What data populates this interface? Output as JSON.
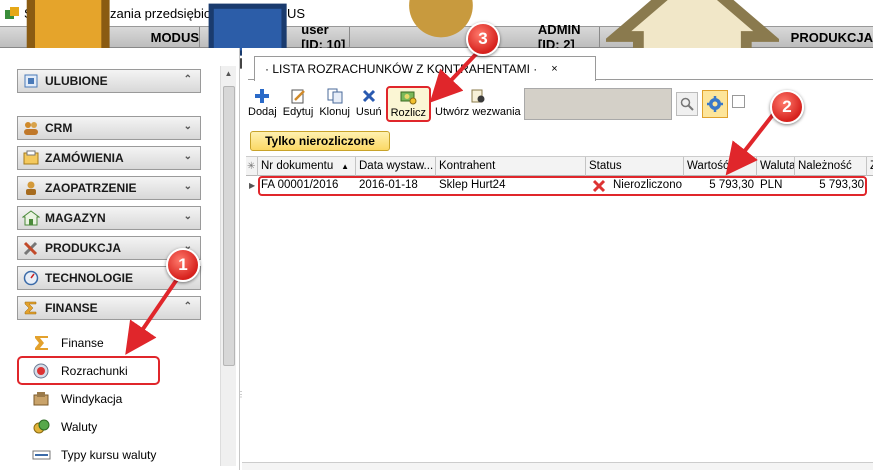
{
  "window": {
    "title": "System zarządzania przedsiębiorstwem MODUS"
  },
  "statusbar": {
    "app": "MODUS",
    "user": "user [ID: 10]",
    "admin": "ADMIN [ID: 2]",
    "module": "PRODUKCJA"
  },
  "sidebar": {
    "groups": [
      {
        "label": "ULUBIONE",
        "icon": "star-folder-icon",
        "chev": "⌃"
      },
      {
        "label": "CRM",
        "icon": "people-icon",
        "chev": "⌄"
      },
      {
        "label": "ZAMÓWIENIA",
        "icon": "order-icon",
        "chev": "⌄"
      },
      {
        "label": "ZAOPATRZENIE",
        "icon": "supply-person-icon",
        "chev": "⌄"
      },
      {
        "label": "MAGAZYN",
        "icon": "warehouse-icon",
        "chev": "⌄"
      },
      {
        "label": "PRODUKCJA",
        "icon": "tools-icon",
        "chev": "⌄"
      },
      {
        "label": "TECHNOLOGIE",
        "icon": "gauge-icon",
        "chev": "⌄"
      },
      {
        "label": "FINANSE",
        "icon": "sigma-icon",
        "chev": "⌃"
      }
    ],
    "finance_items": [
      {
        "label": "Finanse",
        "icon": "sigma-icon"
      },
      {
        "label": "Rozrachunki",
        "icon": "settlements-icon"
      },
      {
        "label": "Windykacja",
        "icon": "collection-icon"
      },
      {
        "label": "Waluty",
        "icon": "coins-icon"
      },
      {
        "label": "Typy kursu waluty",
        "icon": "currency-type-icon"
      }
    ]
  },
  "tab": {
    "title": "· LISTA ROZRACHUNKÓW Z KONTRAHENTAMI ·",
    "close": "×"
  },
  "toolbar": {
    "add": "Dodaj",
    "edit": "Edytuj",
    "clone": "Klonuj",
    "delete": "Usuń",
    "settle": "Rozlicz",
    "create_reminder": "Utwórz wezwania"
  },
  "filter": {
    "label": "Tylko nierozliczone"
  },
  "grid": {
    "columns": [
      "Nr dokumentu",
      "Data wystaw...",
      "Kontrahent",
      "Status",
      "Wartość",
      "Waluta",
      "Należność",
      "Z"
    ],
    "sort_indicator": "▲",
    "rows": [
      {
        "nr": "FA 00001/2016",
        "date": "2016-01-18",
        "contractor": "Sklep Hurt24",
        "status": "Nierozliczono",
        "value": "5 793,30",
        "currency": "PLN",
        "receivable": "5 793,30"
      }
    ]
  },
  "annotations": {
    "b1": "1",
    "b2": "2",
    "b3": "3"
  },
  "colors": {
    "annotation_red": "#e0262b",
    "filter_yellow": "#fbd865"
  }
}
